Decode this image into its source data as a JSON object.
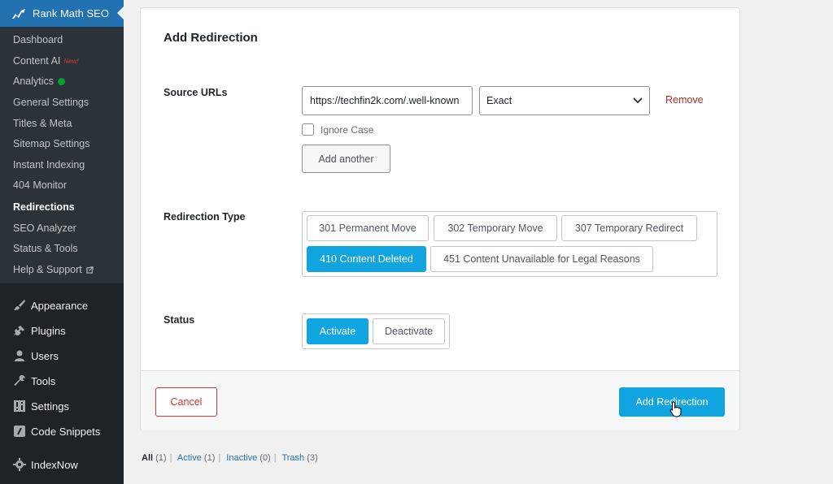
{
  "sidebar": {
    "current_menu": "Rank Math SEO",
    "submenu": [
      {
        "label": "Dashboard"
      },
      {
        "label": "Content AI",
        "badge": "New!"
      },
      {
        "label": "Analytics"
      },
      {
        "label": "General Settings"
      },
      {
        "label": "Titles & Meta"
      },
      {
        "label": "Sitemap Settings"
      },
      {
        "label": "Instant Indexing"
      },
      {
        "label": "404 Monitor"
      },
      {
        "label": "Redirections"
      },
      {
        "label": "SEO Analyzer"
      },
      {
        "label": "Status & Tools"
      },
      {
        "label": "Help & Support"
      }
    ],
    "menu": [
      {
        "label": "Appearance",
        "icon": "brush-icon"
      },
      {
        "label": "Plugins",
        "icon": "plug-icon"
      },
      {
        "label": "Users",
        "icon": "users-icon"
      },
      {
        "label": "Tools",
        "icon": "wrench-icon"
      },
      {
        "label": "Settings",
        "icon": "settings-icon"
      },
      {
        "label": "Code Snippets",
        "icon": "code-icon"
      },
      {
        "label": "IndexNow",
        "icon": "gear-icon"
      }
    ]
  },
  "form": {
    "title": "Add Redirection",
    "source_label": "Source URLs",
    "source_url_value": "https://techfin2k.com/.well-known",
    "match_type": "Exact",
    "remove_label": "Remove",
    "ignore_case_label": "Ignore Case",
    "add_another_label": "Add another",
    "type_label": "Redirection Type",
    "types": [
      "301 Permanent Move",
      "302 Temporary Move",
      "307 Temporary Redirect",
      "410 Content Deleted",
      "451 Content Unavailable for Legal Reasons"
    ],
    "selected_type": "410 Content Deleted",
    "status_label": "Status",
    "status_options": [
      "Activate",
      "Deactivate"
    ],
    "selected_status": "Activate",
    "cancel_label": "Cancel",
    "submit_label": "Add Redirection"
  },
  "filters": [
    {
      "label": "All",
      "count": "(1)"
    },
    {
      "label": "Active",
      "count": "(1)"
    },
    {
      "label": "Inactive",
      "count": "(0)"
    },
    {
      "label": "Trash",
      "count": "(3)"
    }
  ],
  "colors": {
    "accent": "#10a4e0",
    "sidebar_bg": "#1d2327",
    "submenu_bg": "#2c3338",
    "danger": "#d63638"
  }
}
